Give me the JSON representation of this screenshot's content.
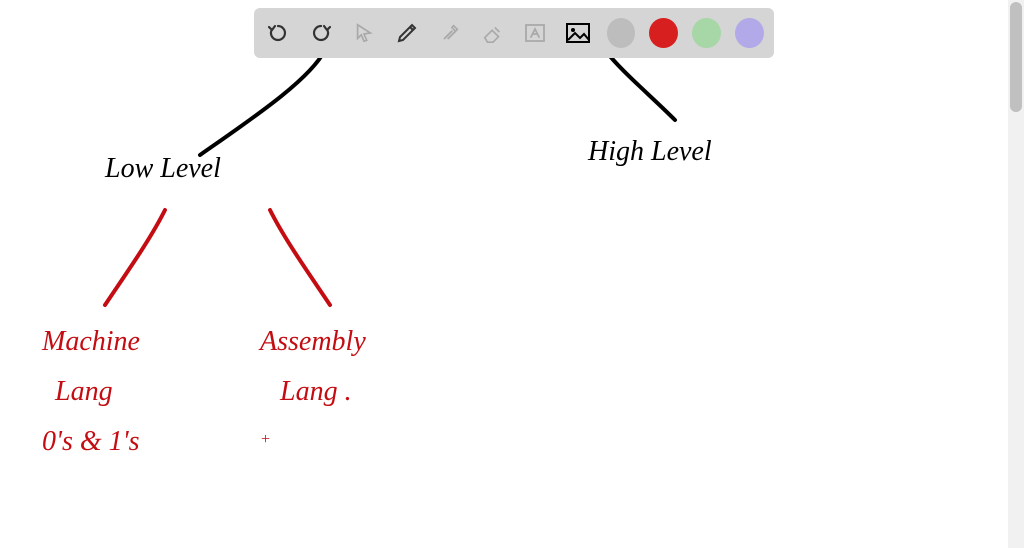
{
  "toolbar": {
    "tools": {
      "undo": "undo",
      "redo": "redo",
      "pointer": "pointer",
      "pencil": "pencil",
      "tools_menu": "tools",
      "eraser": "eraser",
      "text": "text",
      "image": "image"
    },
    "colors": {
      "grey": "#bdbdbd",
      "red": "#d81f1f",
      "green": "#a7d6a7",
      "purple": "#b2a9e8"
    },
    "selected_tool": "pencil",
    "selected_color": "red"
  },
  "canvas": {
    "low_level": "Low Level",
    "high_level": "High Level",
    "machine_lang_1": "Machine",
    "machine_lang_2": "Lang",
    "machine_lang_3": "0's & 1's",
    "assembly_lang_1": "Assembly",
    "assembly_lang_2": "Lang ."
  }
}
